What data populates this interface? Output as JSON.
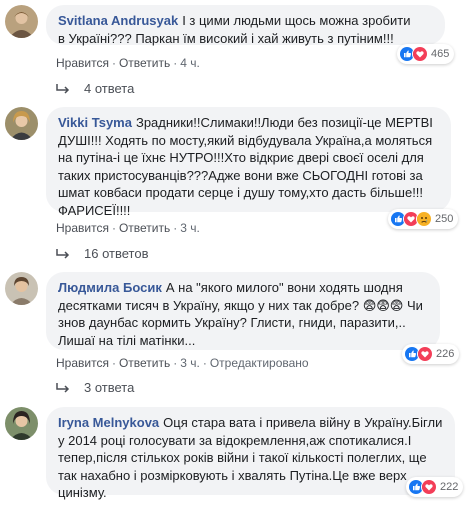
{
  "ui": {
    "like_label": "Нравится",
    "reply_label": "Ответить",
    "sep": "·",
    "edited_label": "Отредактировано"
  },
  "comments": [
    {
      "author": "Svitlana Andrusyak",
      "text": "І з цими людьми щось можна зробити в Україні??? Паркан їм високий і хай живуть з путіним!!!",
      "time": "4 ч.",
      "reactions": "465",
      "replies": "4 ответа"
    },
    {
      "author": "Vikki Tsyma",
      "text": "Зрадники!!Слимаки!!Люди без позиції-це МЕРТВІ ДУШІ!!! Ходять по мосту,який відбудувала Україна,а моляться на путіна-і це їхнє НУТРО!!!Хто відкриє двері своєї оселі для таких пристосуванців???Адже вони вже СЬОГОДНІ готові за шмат ковбаси продати серце і душу тому,хто дасть більше!!! ФАРИСЕЇ!!!!",
      "time": "3 ч.",
      "reactions": "250",
      "replies": "16 ответов"
    },
    {
      "author": "Людмила Босик",
      "text": "А на \"якого милого\" вони ходять шодня десятками тисяч в Україну, якщо у них так добре? 😨😨😨 Чи знов даунбас кормить Україну? Глисти, гниди, паразити,.. Лишаї на тілі матінки...",
      "time": "3 ч.",
      "reactions": "226",
      "replies": "3 ответа"
    },
    {
      "author": "Iryna Melnykova",
      "text": "Оця стара вата і привела війну в Україну.Бігли у 2014 році голосувати за відокремлення,аж спотикалися.І тепер,після стількох років війни і такої кількості полеглих, ще так нахабно і розмірковують і хвалять Путіна.Це вже верх цинізму.",
      "reactions": "222"
    }
  ],
  "colors": {
    "like": "#1877f2",
    "love": "#f33e58",
    "haha": "#f7b125",
    "author": "#385898",
    "bubble": "#f2f3f5"
  }
}
